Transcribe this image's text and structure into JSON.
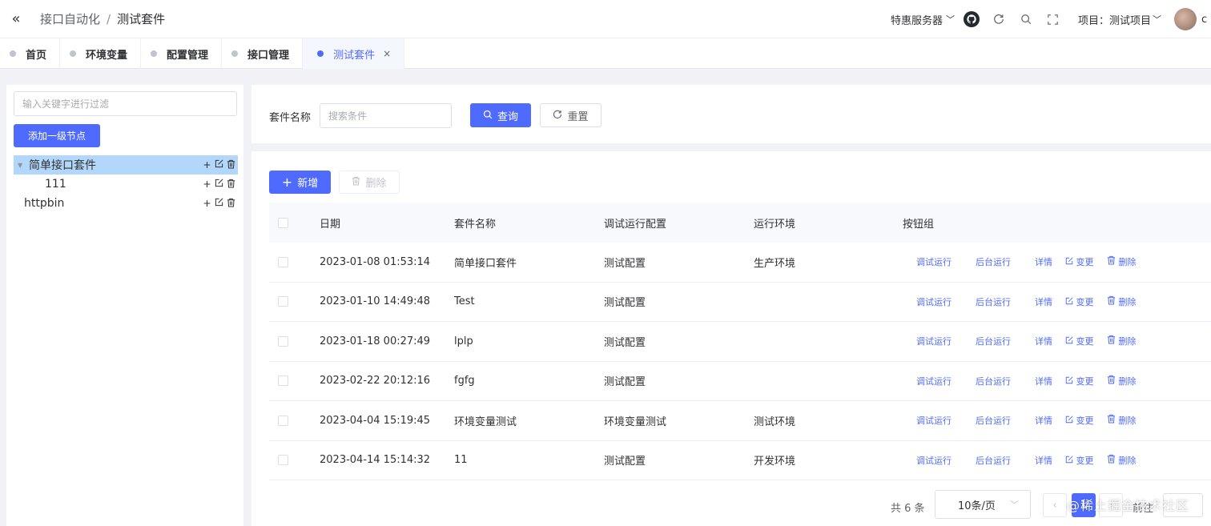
{
  "topbar": {
    "collapse_glyph": "«",
    "breadcrumb": [
      "接口自动化",
      "测试套件"
    ],
    "breadcrumb_sep": "/",
    "server_label": "特惠服务器",
    "github_icon": "github-icon",
    "project_label": "项目：测试项目",
    "username": "c"
  },
  "tabs": [
    {
      "label": "首页",
      "active": false
    },
    {
      "label": "环境变量",
      "active": false
    },
    {
      "label": "配置管理",
      "active": false
    },
    {
      "label": "接口管理",
      "active": false
    },
    {
      "label": "测试套件",
      "active": true,
      "close": "×"
    }
  ],
  "sidebar": {
    "filter_placeholder": "输入关键字进行过滤",
    "add_root_label": "添加一级节点",
    "tree": [
      {
        "label": "简单接口套件",
        "level": 0,
        "expanded": true,
        "selected": true
      },
      {
        "label": "111",
        "level": 1,
        "expanded": false,
        "selected": false
      },
      {
        "label": "httpbin",
        "level": 0,
        "expanded": false,
        "selected": false
      }
    ],
    "node_actions": [
      "+",
      "✎",
      "🗑"
    ]
  },
  "search": {
    "label": "套件名称",
    "placeholder": "搜索条件",
    "query_label": "查询",
    "reset_label": "重置"
  },
  "toolbar": {
    "add_label": "新增",
    "delete_label": "删除"
  },
  "table": {
    "headers": [
      "日期",
      "套件名称",
      "调试运行配置",
      "运行环境",
      "按钮组"
    ],
    "rows": [
      {
        "date": "2023-01-08 01:53:14",
        "name": "简单接口套件",
        "config": "测试配置",
        "env": "生产环境"
      },
      {
        "date": "2023-01-10 14:49:48",
        "name": "Test",
        "config": "测试配置",
        "env": ""
      },
      {
        "date": "2023-01-18 00:27:49",
        "name": "lplp",
        "config": "测试配置",
        "env": ""
      },
      {
        "date": "2023-02-22 20:12:16",
        "name": "fgfg",
        "config": "测试配置",
        "env": ""
      },
      {
        "date": "2023-04-04 15:19:45",
        "name": "环境变量测试",
        "config": "环境变量测试",
        "env": "测试环境"
      },
      {
        "date": "2023-04-14 15:14:32",
        "name": "11",
        "config": "测试配置",
        "env": "开发环境"
      }
    ],
    "ops": {
      "debug": "调试运行",
      "background": "后台运行",
      "detail": "详情",
      "edit": "变更",
      "delete": "删除"
    }
  },
  "pagination": {
    "total": "共 6 条",
    "page_size": "10条/页",
    "current_page": "1",
    "jump_label": "前往"
  },
  "watermark": "@稀土掘金技术社区",
  "colors": {
    "primary": "#4f6bff",
    "selected_node": "#b3d6fb"
  }
}
